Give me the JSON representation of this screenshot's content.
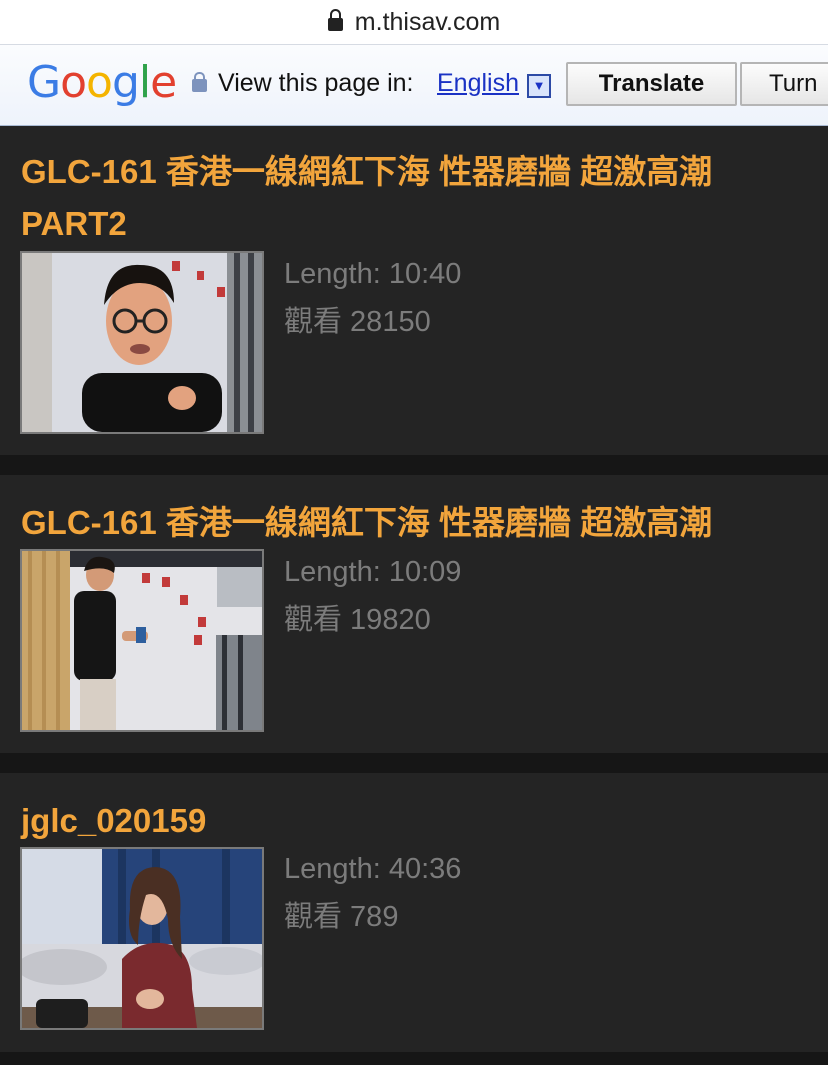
{
  "browser": {
    "url": "m.thisav.com"
  },
  "translate_bar": {
    "logo": "Google",
    "view_label": "View this page in:",
    "language": "English",
    "dropdown_symbol": "▼",
    "translate_button": "Translate",
    "turn_off_button": "Turn"
  },
  "videos": [
    {
      "title": "GLC-161 香港一線網紅下海 性器磨牆 超激高潮 PART2",
      "length": "Length: 10:40",
      "views": "觀看 28150"
    },
    {
      "title": "GLC-161 香港一線網紅下海 性器磨牆 超激高潮",
      "length": "Length: 10:09",
      "views": "觀看 19820"
    },
    {
      "title": "jglc_020159",
      "length": "Length: 40:36",
      "views": "觀看 789"
    }
  ],
  "colors": {
    "title": "#f2a53c",
    "meta_text": "#7c7c7c",
    "card_bg": "#242424",
    "page_bg": "#161616"
  }
}
